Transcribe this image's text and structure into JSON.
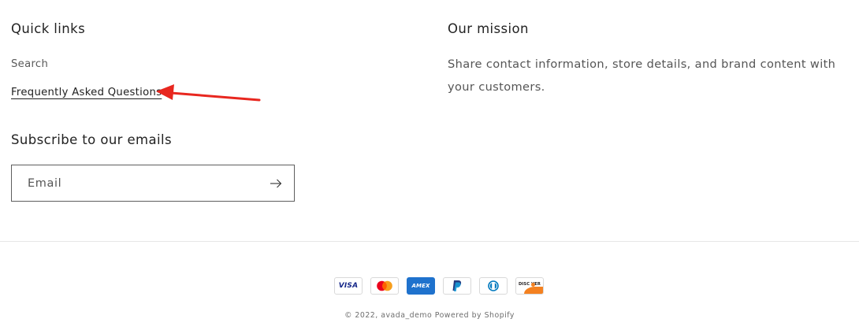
{
  "quick_links": {
    "title": "Quick links",
    "items": [
      {
        "label": "Search"
      },
      {
        "label": "Frequently Asked Questions"
      }
    ]
  },
  "mission": {
    "title": "Our mission",
    "text": "Share contact information, store details, and brand content with your customers."
  },
  "subscribe": {
    "title": "Subscribe to our emails",
    "email_placeholder": "Email",
    "submit_icon": "arrow-right-icon"
  },
  "payments": {
    "icons": [
      "visa-icon",
      "mastercard-icon",
      "amex-icon",
      "paypal-icon",
      "diners-club-icon",
      "discover-icon"
    ],
    "visa_label": "VISA",
    "amex_label": "AMEX",
    "discover_label": "DISC VER"
  },
  "copyright": {
    "prefix": "© 2022, ",
    "store": "avada_demo",
    "powered": "Powered by Shopify"
  },
  "colors": {
    "annotation_arrow": "#e8271f",
    "mastercard_red": "#eb001b",
    "mastercard_yellow": "#f79e1b",
    "amex_blue": "#1f72cd",
    "paypal_dark": "#253b80",
    "paypal_light": "#179bd7",
    "diners_blue": "#0079be",
    "discover_orange": "#f48120"
  }
}
